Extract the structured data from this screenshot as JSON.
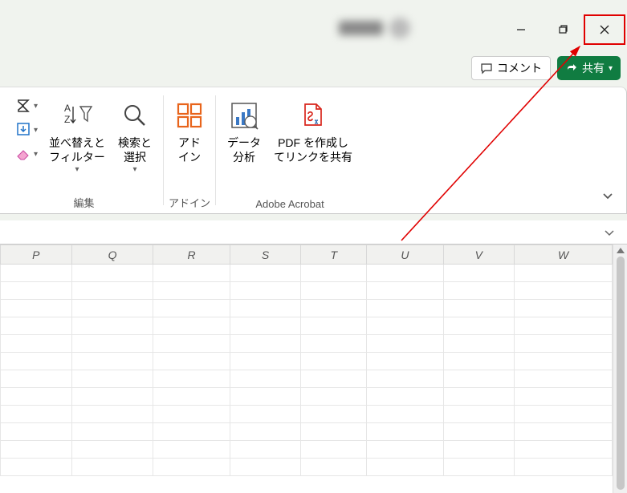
{
  "window": {
    "minimize_tip": "Minimize",
    "restore_tip": "Restore",
    "close_tip": "Close"
  },
  "actions": {
    "comment_label": "コメント",
    "share_label": "共有"
  },
  "ribbon": {
    "groups": {
      "editing": {
        "label": "編集",
        "sort_filter": "並べ替えと\nフィルター",
        "find_select": "検索と\n選択"
      },
      "addins": {
        "label": "アドイン",
        "addins_btn": "アド\nイン"
      },
      "acrobat": {
        "label": "Adobe Acrobat",
        "data_analysis": "データ\n分析",
        "pdf_create": "PDF を作成し\nてリンクを共有"
      }
    }
  },
  "columns": [
    "P",
    "Q",
    "R",
    "S",
    "T",
    "U",
    "V",
    "W"
  ]
}
